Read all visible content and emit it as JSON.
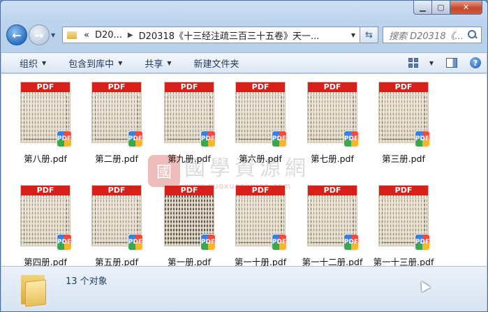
{
  "window": {
    "caption_buttons": [
      "minimize",
      "maximize",
      "close"
    ]
  },
  "nav": {
    "breadcrumb_prefix": "«",
    "crumb1": "D20...",
    "crumb2": "D20318《十三经注疏三百三十五卷》天一...",
    "search_placeholder": "搜索 D20318《..."
  },
  "toolbar": {
    "organize": "组织",
    "include_library": "包含到库中",
    "share": "共享",
    "new_folder": "新建文件夹"
  },
  "files": [
    {
      "name": "第八册.pdf",
      "banner": "PDF",
      "badge": "PDF"
    },
    {
      "name": "第二册.pdf",
      "banner": "PDF",
      "badge": "PDF"
    },
    {
      "name": "第九册.pdf",
      "banner": "PDF",
      "badge": "PDF"
    },
    {
      "name": "第六册.pdf",
      "banner": "PDF",
      "badge": "PDF"
    },
    {
      "name": "第七册.pdf",
      "banner": "PDF",
      "badge": "PDF"
    },
    {
      "name": "第三册.pdf",
      "banner": "PDF",
      "badge": "PDF"
    },
    {
      "name": "第四册.pdf",
      "banner": "PDF",
      "badge": "PDF"
    },
    {
      "name": "第五册.pdf",
      "banner": "PDF",
      "badge": "PDF"
    },
    {
      "name": "第一册.pdf",
      "banner": "PDF",
      "badge": "PDF"
    },
    {
      "name": "第一十册.pdf",
      "banner": "PDF",
      "badge": "PDF"
    },
    {
      "name": "第一十二册.pdf",
      "banner": "PDF",
      "badge": "PDF"
    },
    {
      "name": "第一十三册.pdf",
      "banner": "PDF",
      "badge": "PDF"
    }
  ],
  "watermark": {
    "seal": "國",
    "cn": "國學資源網",
    "url": "www.guoxueziyuan.com"
  },
  "status": {
    "count_text": "13 个对象"
  }
}
